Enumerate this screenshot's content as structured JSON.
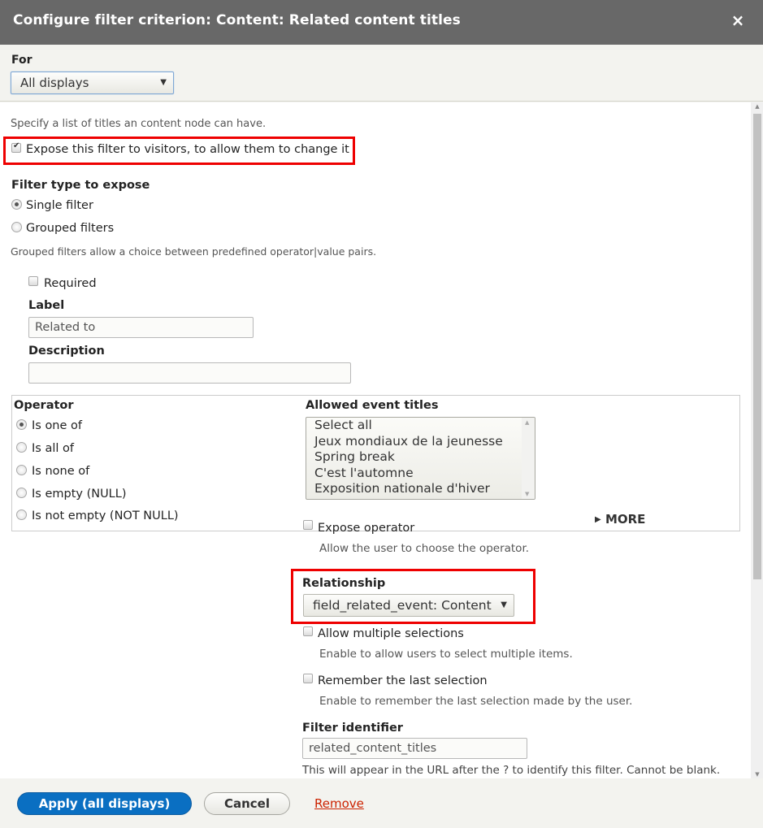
{
  "dialog": {
    "title": "Configure filter criterion: Content: Related content titles",
    "close_icon": "×"
  },
  "for_section": {
    "label": "For",
    "selected": "All displays"
  },
  "description": "Specify a list of titles an content node can have.",
  "expose_checkbox": {
    "label": "Expose this filter to visitors, to allow them to change it",
    "checked": true
  },
  "filter_type": {
    "heading": "Filter type to expose",
    "options": [
      {
        "label": "Single filter",
        "checked": true
      },
      {
        "label": "Grouped filters",
        "checked": false
      }
    ],
    "help": "Grouped filters allow a choice between predefined operator|value pairs."
  },
  "required": {
    "label": "Required",
    "checked": false
  },
  "label_field": {
    "label": "Label",
    "value": "Related to"
  },
  "description_field": {
    "label": "Description",
    "value": ""
  },
  "operator": {
    "heading": "Operator",
    "options": [
      {
        "label": "Is one of",
        "checked": true
      },
      {
        "label": "Is all of",
        "checked": false
      },
      {
        "label": "Is none of",
        "checked": false
      },
      {
        "label": "Is empty (NULL)",
        "checked": false
      },
      {
        "label": "Is not empty (NOT NULL)",
        "checked": false
      }
    ]
  },
  "allowed_titles": {
    "heading": "Allowed event titles",
    "options": [
      "Select all",
      "Jeux mondiaux de la jeunesse",
      "Spring break",
      "C'est l'automne",
      "Exposition nationale d'hiver"
    ]
  },
  "more": {
    "label": "MORE",
    "icon": "▶"
  },
  "expose_operator": {
    "label": "Expose operator",
    "checked": false,
    "help": "Allow the user to choose the operator."
  },
  "relationship": {
    "label": "Relationship",
    "selected": "field_related_event: Content"
  },
  "allow_multiple": {
    "label": "Allow multiple selections",
    "checked": false,
    "help": "Enable to allow users to select multiple items."
  },
  "remember": {
    "label": "Remember the last selection",
    "checked": false,
    "help": "Enable to remember the last selection made by the user."
  },
  "identifier": {
    "label": "Filter identifier",
    "value": "related_content_titles",
    "help": "This will appear in the URL after the ? to identify this filter. Cannot be blank."
  },
  "footer": {
    "apply": "Apply (all displays)",
    "cancel": "Cancel",
    "remove": "Remove"
  },
  "colors": {
    "titlebar": "#686868",
    "primary": "#0a6fc2",
    "highlight": "#ee0000",
    "remove_link": "#cc2200"
  }
}
